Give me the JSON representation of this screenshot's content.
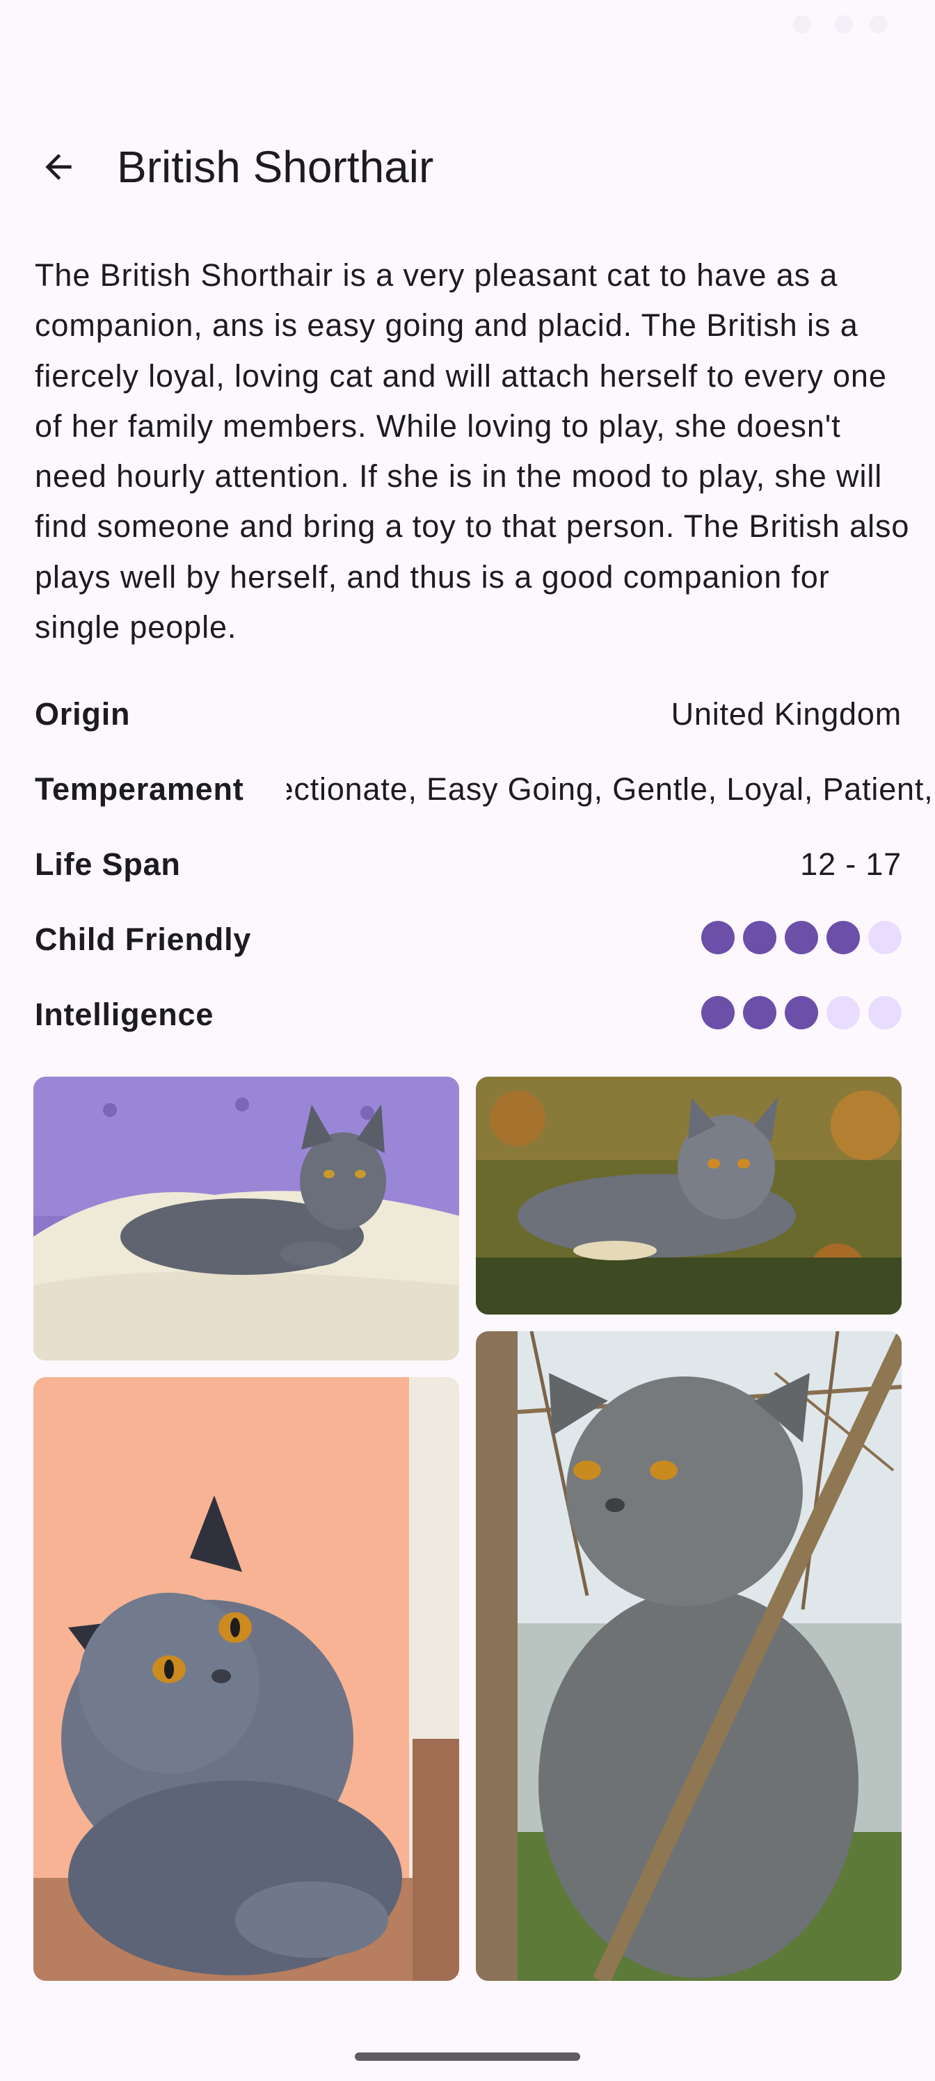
{
  "header": {
    "title": "British Shorthair"
  },
  "breed": {
    "description": "The British Shorthair is a very pleasant cat to have as a companion, ans is easy going and placid. The British is a fiercely loyal, loving cat and will attach herself to every one of her family members. While loving to play, she doesn't need hourly attention. If she is in the mood to play, she will find someone and bring a toy to that person. The British also plays well by herself, and thus is a good companion for single people.",
    "attributes": {
      "origin": {
        "label": "Origin",
        "value": "United Kingdom"
      },
      "temperament": {
        "label": "Temperament",
        "value": "Affectionate, Easy Going, Gentle, Loyal, Patient, calm"
      },
      "life_span": {
        "label": "Life Span",
        "value": "12 - 17"
      },
      "child_friendly": {
        "label": "Child Friendly",
        "rating": 4,
        "max": 5
      },
      "intelligence": {
        "label": "Intelligence",
        "rating": 3,
        "max": 5
      }
    }
  },
  "gallery": {
    "photos": [
      {
        "subject": "grey cat lying on white fur rug, lavender background"
      },
      {
        "subject": "grey cat lying on autumn leaves"
      },
      {
        "subject": "grey cat with orange eyes, peach wall background"
      },
      {
        "subject": "grey cat sitting among bare branches"
      }
    ]
  },
  "colors": {
    "background": "#fdf8fd",
    "rating_filled": "#6b4fa8",
    "rating_empty": "#e9ddff"
  },
  "icons": {
    "back": "arrow-back-icon"
  }
}
